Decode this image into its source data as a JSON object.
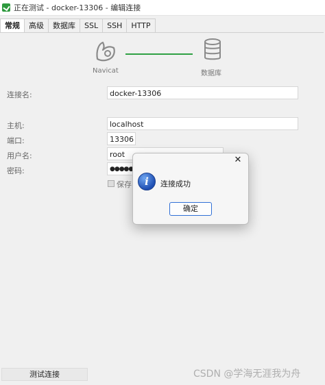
{
  "window": {
    "title": "正在测试 - docker-13306 - 编辑连接"
  },
  "tabs": [
    {
      "label": "常规",
      "active": true
    },
    {
      "label": "高级",
      "active": false
    },
    {
      "label": "数据库",
      "active": false
    },
    {
      "label": "SSL",
      "active": false
    },
    {
      "label": "SSH",
      "active": false
    },
    {
      "label": "HTTP",
      "active": false
    }
  ],
  "diagram": {
    "left_label": "Navicat",
    "right_label": "数据库",
    "line_color": "#2ea043"
  },
  "form": {
    "connection_name": {
      "label": "连接名:",
      "value": "docker-13306"
    },
    "host": {
      "label": "主机:",
      "value": "localhost"
    },
    "port": {
      "label": "端口:",
      "value": "13306"
    },
    "username": {
      "label": "用户名:",
      "value": "root"
    },
    "password": {
      "label": "密码:",
      "value": "●●●●●"
    },
    "save_password": {
      "label": "保存"
    }
  },
  "footer": {
    "test_button": "测试连接"
  },
  "watermark": "CSDN @学海无涯我为舟",
  "dialog": {
    "close": "✕",
    "icon": "i",
    "message": "连接成功",
    "ok_label": "确定",
    "accent": "#2f6fd6"
  }
}
